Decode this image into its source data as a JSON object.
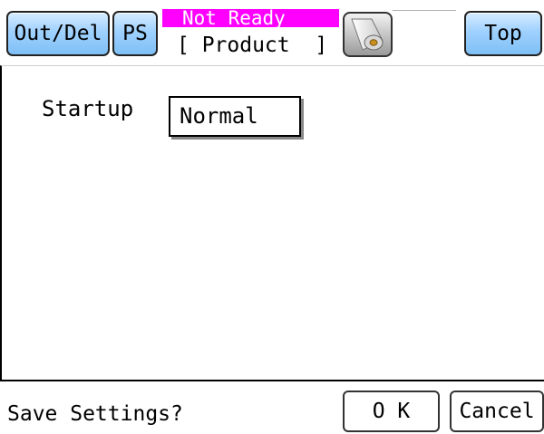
{
  "header": {
    "out_del_label": "Out/Del",
    "ps_label": "PS",
    "status_text": "Not Ready",
    "mode_text": "[ Product  ]",
    "paper_roll_icon": "paper-roll-icon",
    "top_label": "Top"
  },
  "settings": {
    "startup_label": "Startup",
    "startup_value": "Normal"
  },
  "footer": {
    "prompt": "Save Settings?",
    "ok_label": "O K",
    "cancel_label": "Cancel"
  },
  "colors": {
    "status_bg": "#ff00ff",
    "status_text": "#ffffff",
    "button_blue": "#9fd1ff"
  }
}
